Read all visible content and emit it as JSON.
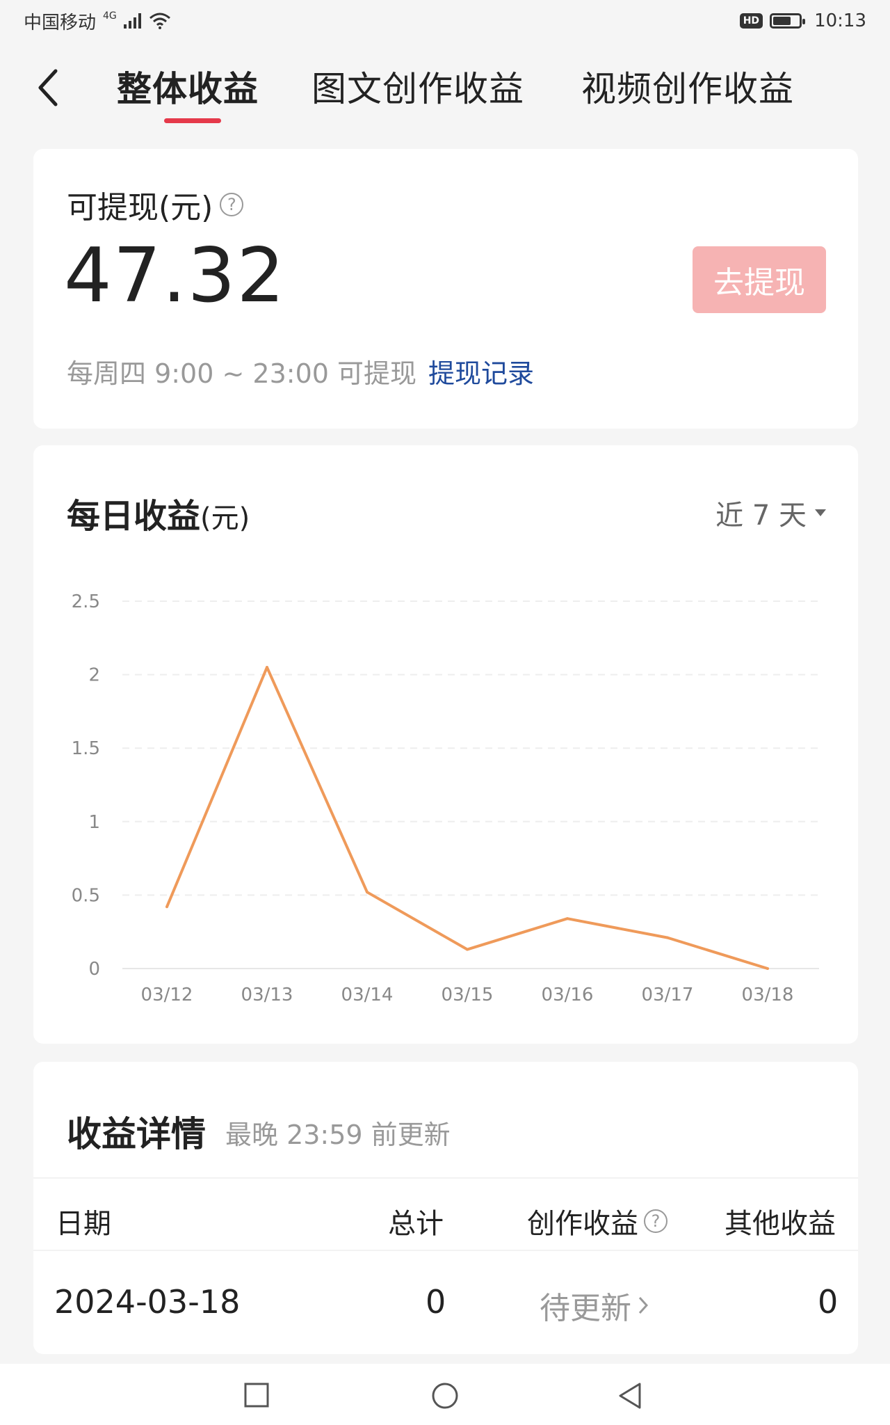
{
  "status_bar": {
    "carrier": "中国移动",
    "network": "4G",
    "hd": "HD",
    "battery_level": 0.7,
    "time": "10:13"
  },
  "nav": {
    "tabs": [
      {
        "label": "整体收益",
        "active": true
      },
      {
        "label": "图文创作收益",
        "active": false
      },
      {
        "label": "视频创作收益",
        "active": false
      }
    ]
  },
  "balance": {
    "label": "可提现(元)",
    "help_icon": "question-circle-icon",
    "amount": "47.32",
    "withdraw_button": "去提现",
    "schedule_note": "每周四 9:00 ~ 23:00 可提现",
    "records_link": "提现记录"
  },
  "daily": {
    "title": "每日收益",
    "unit": "(元)",
    "range_label": "近 7 天"
  },
  "chart_data": {
    "type": "line",
    "categories": [
      "03/12",
      "03/13",
      "03/14",
      "03/15",
      "03/16",
      "03/17",
      "03/18"
    ],
    "values": [
      0.42,
      2.05,
      0.52,
      0.13,
      0.34,
      0.21,
      0.0
    ],
    "y_ticks": [
      "0",
      "0.5",
      "1",
      "1.5",
      "2",
      "2.5"
    ],
    "ylim": [
      0,
      2.5
    ],
    "grid": true,
    "line_color": "#ef9a5a"
  },
  "details": {
    "title": "收益详情",
    "subtitle": "最晚 23:59 前更新",
    "columns": [
      "日期",
      "总计",
      "创作收益",
      "其他收益"
    ],
    "rows": [
      {
        "date": "2024-03-18",
        "total": "0",
        "creation": "待更新",
        "other": "0"
      }
    ]
  }
}
